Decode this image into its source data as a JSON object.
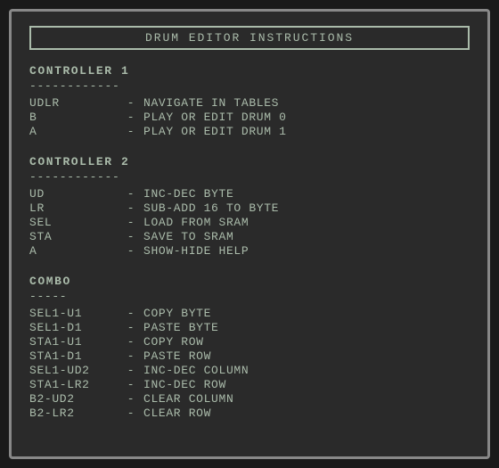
{
  "title": "DRUM  EDITOR  INSTRUCTIONS",
  "sections": [
    {
      "id": "controller1",
      "label": "CONTROLLER 1",
      "divider": "------------",
      "rows": [
        {
          "key": "UDLR",
          "dash": "-",
          "desc": "NAVIGATE IN TABLES"
        },
        {
          "key": "B",
          "dash": "-",
          "desc": "PLAY OR EDIT DRUM 0"
        },
        {
          "key": "A",
          "dash": "-",
          "desc": "PLAY OR EDIT DRUM 1"
        }
      ]
    },
    {
      "id": "controller2",
      "label": "CONTROLLER 2",
      "divider": "------------",
      "rows": [
        {
          "key": "UD",
          "dash": "-",
          "desc": "INC-DEC BYTE"
        },
        {
          "key": "LR",
          "dash": "-",
          "desc": "SUB-ADD 16 TO BYTE"
        },
        {
          "key": "SEL",
          "dash": "-",
          "desc": "LOAD FROM SRAM"
        },
        {
          "key": "STA",
          "dash": "-",
          "desc": "SAVE TO SRAM"
        },
        {
          "key": "A",
          "dash": "-",
          "desc": "SHOW-HIDE HELP"
        }
      ]
    },
    {
      "id": "combo",
      "label": "COMBO",
      "divider": "-----",
      "rows": [
        {
          "key": "SEL1-U1",
          "dash": "-",
          "desc": "COPY BYTE"
        },
        {
          "key": "SEL1-D1",
          "dash": "-",
          "desc": "PASTE BYTE"
        },
        {
          "key": "STA1-U1",
          "dash": "-",
          "desc": "COPY ROW"
        },
        {
          "key": "STA1-D1",
          "dash": "-",
          "desc": "PASTE ROW"
        },
        {
          "key": "SEL1-UD2",
          "dash": "-",
          "desc": "INC-DEC COLUMN"
        },
        {
          "key": "STA1-LR2",
          "dash": "-",
          "desc": "INC-DEC ROW"
        },
        {
          "key": "B2-UD2",
          "dash": "-",
          "desc": "CLEAR COLUMN"
        },
        {
          "key": "B2-LR2",
          "dash": "-",
          "desc": "CLEAR ROW"
        }
      ]
    }
  ]
}
